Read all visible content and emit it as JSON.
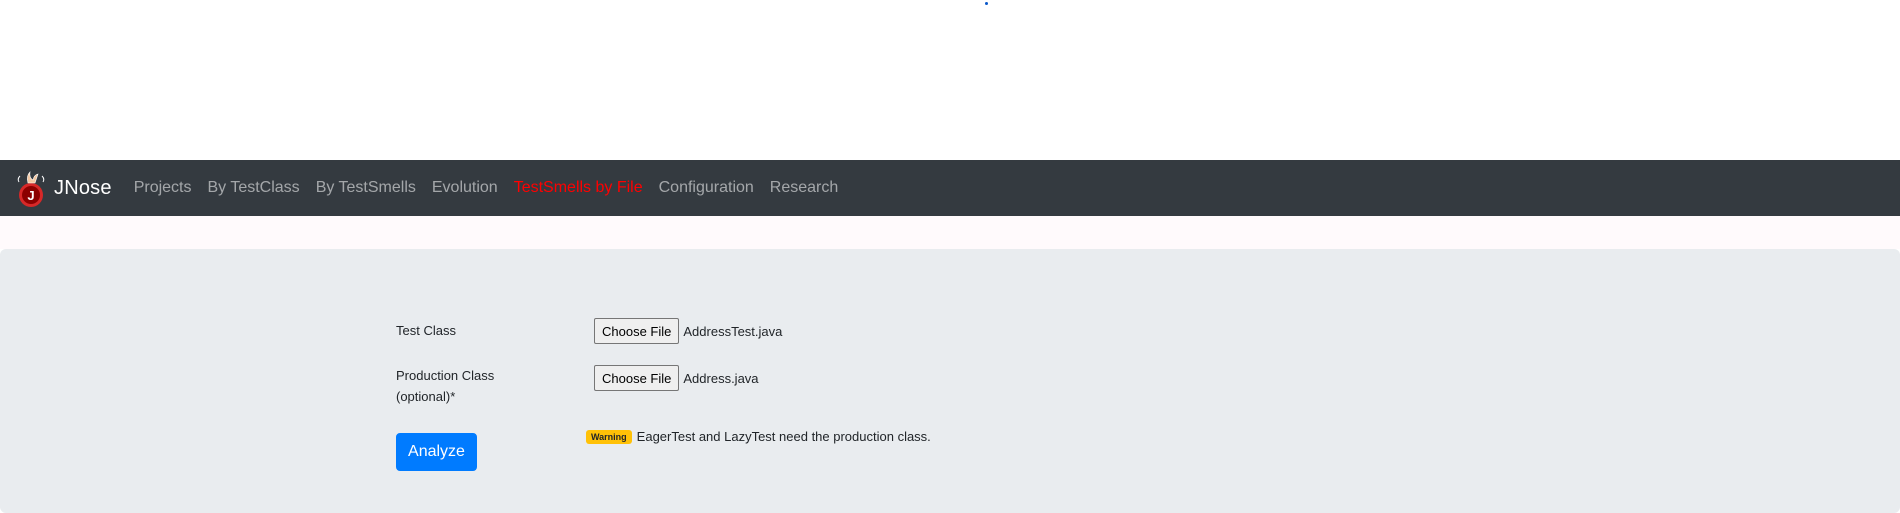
{
  "navbar": {
    "brand": "JNose",
    "items": [
      {
        "label": "Projects",
        "active": false
      },
      {
        "label": "By TestClass",
        "active": false
      },
      {
        "label": "By TestSmells",
        "active": false
      },
      {
        "label": "Evolution",
        "active": false
      },
      {
        "label": "TestSmells by File",
        "active": true
      },
      {
        "label": "Configuration",
        "active": false
      },
      {
        "label": "Research",
        "active": false
      }
    ]
  },
  "form": {
    "test_class_label": "Test Class",
    "production_class_label": "Production Class (optional)*",
    "choose_file_label": "Choose File",
    "test_class_file": "AddressTest.java",
    "production_class_file": "Address.java",
    "analyze_label": "Analyze",
    "warning_badge": "Warning",
    "warning_text": "EagerTest and LazyTest need the production class."
  },
  "colors": {
    "navbar_bg": "#343a40",
    "active_nav": "#ff0000",
    "primary": "#007bff",
    "warning": "#ffc107",
    "panel_bg": "#e9ecef"
  },
  "icons": {
    "brand_logo": "jnose-logo-icon"
  }
}
